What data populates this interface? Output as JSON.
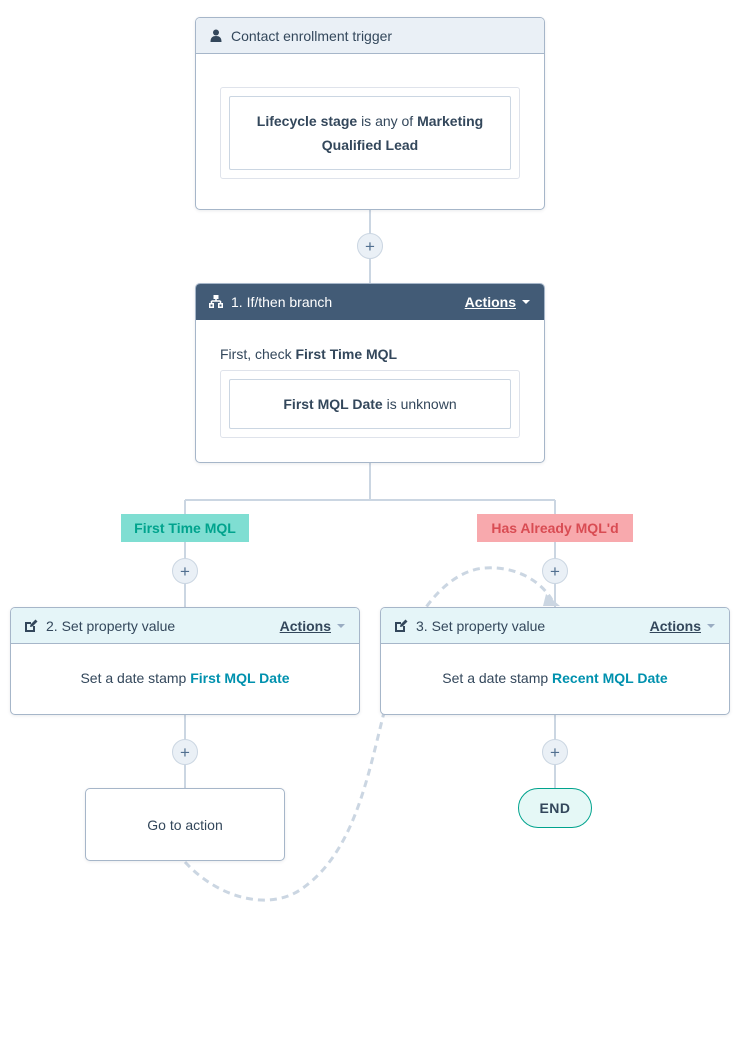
{
  "trigger": {
    "title": "Contact enrollment trigger",
    "icon": "person-icon",
    "filter": {
      "property": "Lifecycle stage",
      "operator": "is any of",
      "value_line1": "Marketing",
      "value_line2": "Qualified Lead"
    }
  },
  "branch": {
    "title": "1. If/then branch",
    "icon": "branch-icon",
    "actions_label": "Actions",
    "check_prefix": "First, check",
    "check_name": "First Time MQL",
    "filter": {
      "property": "First MQL Date",
      "operator": "is unknown"
    },
    "branches": [
      {
        "label": "First Time MQL",
        "color_bg": "#7fded2",
        "color_text": "#00a38d"
      },
      {
        "label": "Has Already MQL'd",
        "color_bg": "#f8a9ad",
        "color_text": "#d94c53"
      }
    ]
  },
  "actions": [
    {
      "title": "2. Set property value",
      "icon": "edit-icon",
      "actions_label": "Actions",
      "text_prefix": "Set a date stamp",
      "property": "First MQL Date"
    },
    {
      "title": "3. Set property value",
      "icon": "edit-icon",
      "actions_label": "Actions",
      "text_prefix": "Set a date stamp",
      "property": "Recent MQL Date"
    }
  ],
  "goto": {
    "label": "Go to action"
  },
  "end": {
    "label": "END"
  },
  "plus_label": "+",
  "colors": {
    "connector": "#cbd6e2",
    "dark_header": "#425b76",
    "link": "#0091ae",
    "end_border": "#00a38d"
  }
}
